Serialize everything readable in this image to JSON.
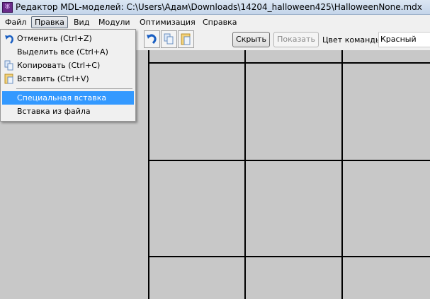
{
  "window": {
    "title": "Редактор MDL-моделей: C:\\Users\\Адам\\Downloads\\14204_halloween425\\HalloweenNone.mdx"
  },
  "menubar": [
    "Файл",
    "Правка",
    "Вид",
    "Модули",
    "Оптимизация",
    "Справка"
  ],
  "edit_menu": {
    "items": [
      {
        "label": "Отменить (Ctrl+Z)",
        "icon": "undo-icon"
      },
      {
        "label": "Выделить все (Ctrl+A)"
      },
      {
        "label": "Копировать (Ctrl+C)",
        "icon": "copy-icon"
      },
      {
        "label": "Вставить (Ctrl+V)",
        "icon": "paste-icon"
      },
      {
        "label": "Специальная вставка",
        "highlighted": true
      },
      {
        "label": "Вставка из файла"
      }
    ]
  },
  "toolbar": {
    "hide_label": "Скрыть",
    "show_label": "Показать",
    "team_color_label": "Цвет команды:",
    "team_color_value": "Красный"
  },
  "colors": {
    "highlight": "#3399ff",
    "canvas": "#c8c8c8"
  }
}
